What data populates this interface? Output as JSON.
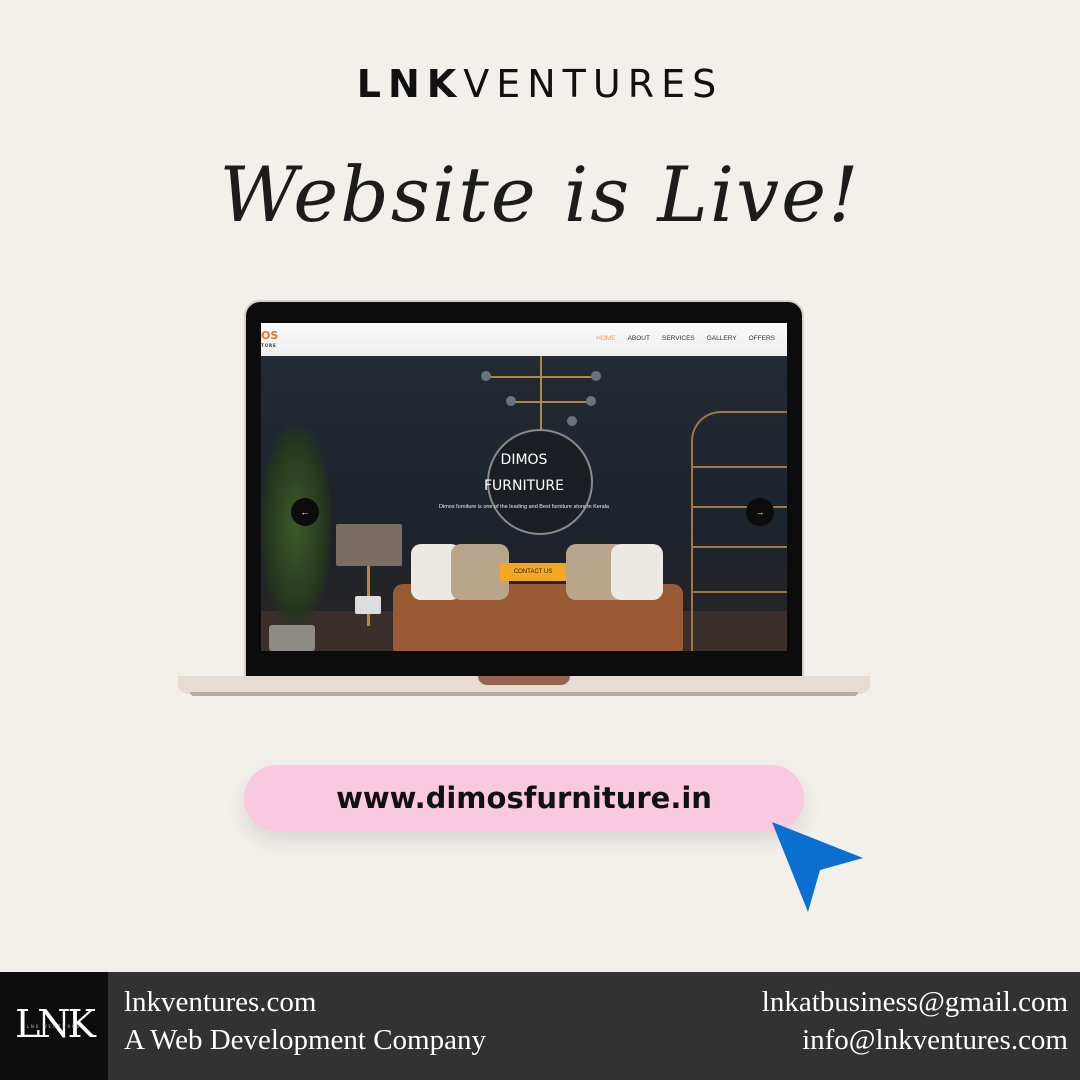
{
  "header": {
    "brand_bold": "LNK",
    "brand_light": "VENTURES",
    "tagline": "Website is Live!"
  },
  "laptop_site": {
    "logo_text": "OS",
    "logo_sub": "TURE",
    "nav": [
      {
        "label": "HOME",
        "active": true
      },
      {
        "label": "ABOUT",
        "active": false
      },
      {
        "label": "SERVICES",
        "active": false
      },
      {
        "label": "GALLERY",
        "active": false
      },
      {
        "label": "OFFERS",
        "active": false
      }
    ],
    "hero_title_line1": "DIMOS",
    "hero_title_line2": "FURNITURE",
    "hero_subtitle": "Dimos furniture is one of the leading and Best furniture store in Kerala",
    "cta_label": "CONTACT US",
    "prev_arrow": "←",
    "next_arrow": "→",
    "accent_color": "#f5a623"
  },
  "url_pill": {
    "url": "www.dimosfurniture.in",
    "background": "#f9c9df",
    "cursor_color": "#0b6fcf"
  },
  "footer": {
    "logo_text": "LNK",
    "logo_sub": "LNK VENTURES",
    "website": "lnkventures.com",
    "description": "A Web Development Company",
    "email_1": "lnkatbusiness@gmail.com",
    "email_2": "info@lnkventures.com"
  }
}
